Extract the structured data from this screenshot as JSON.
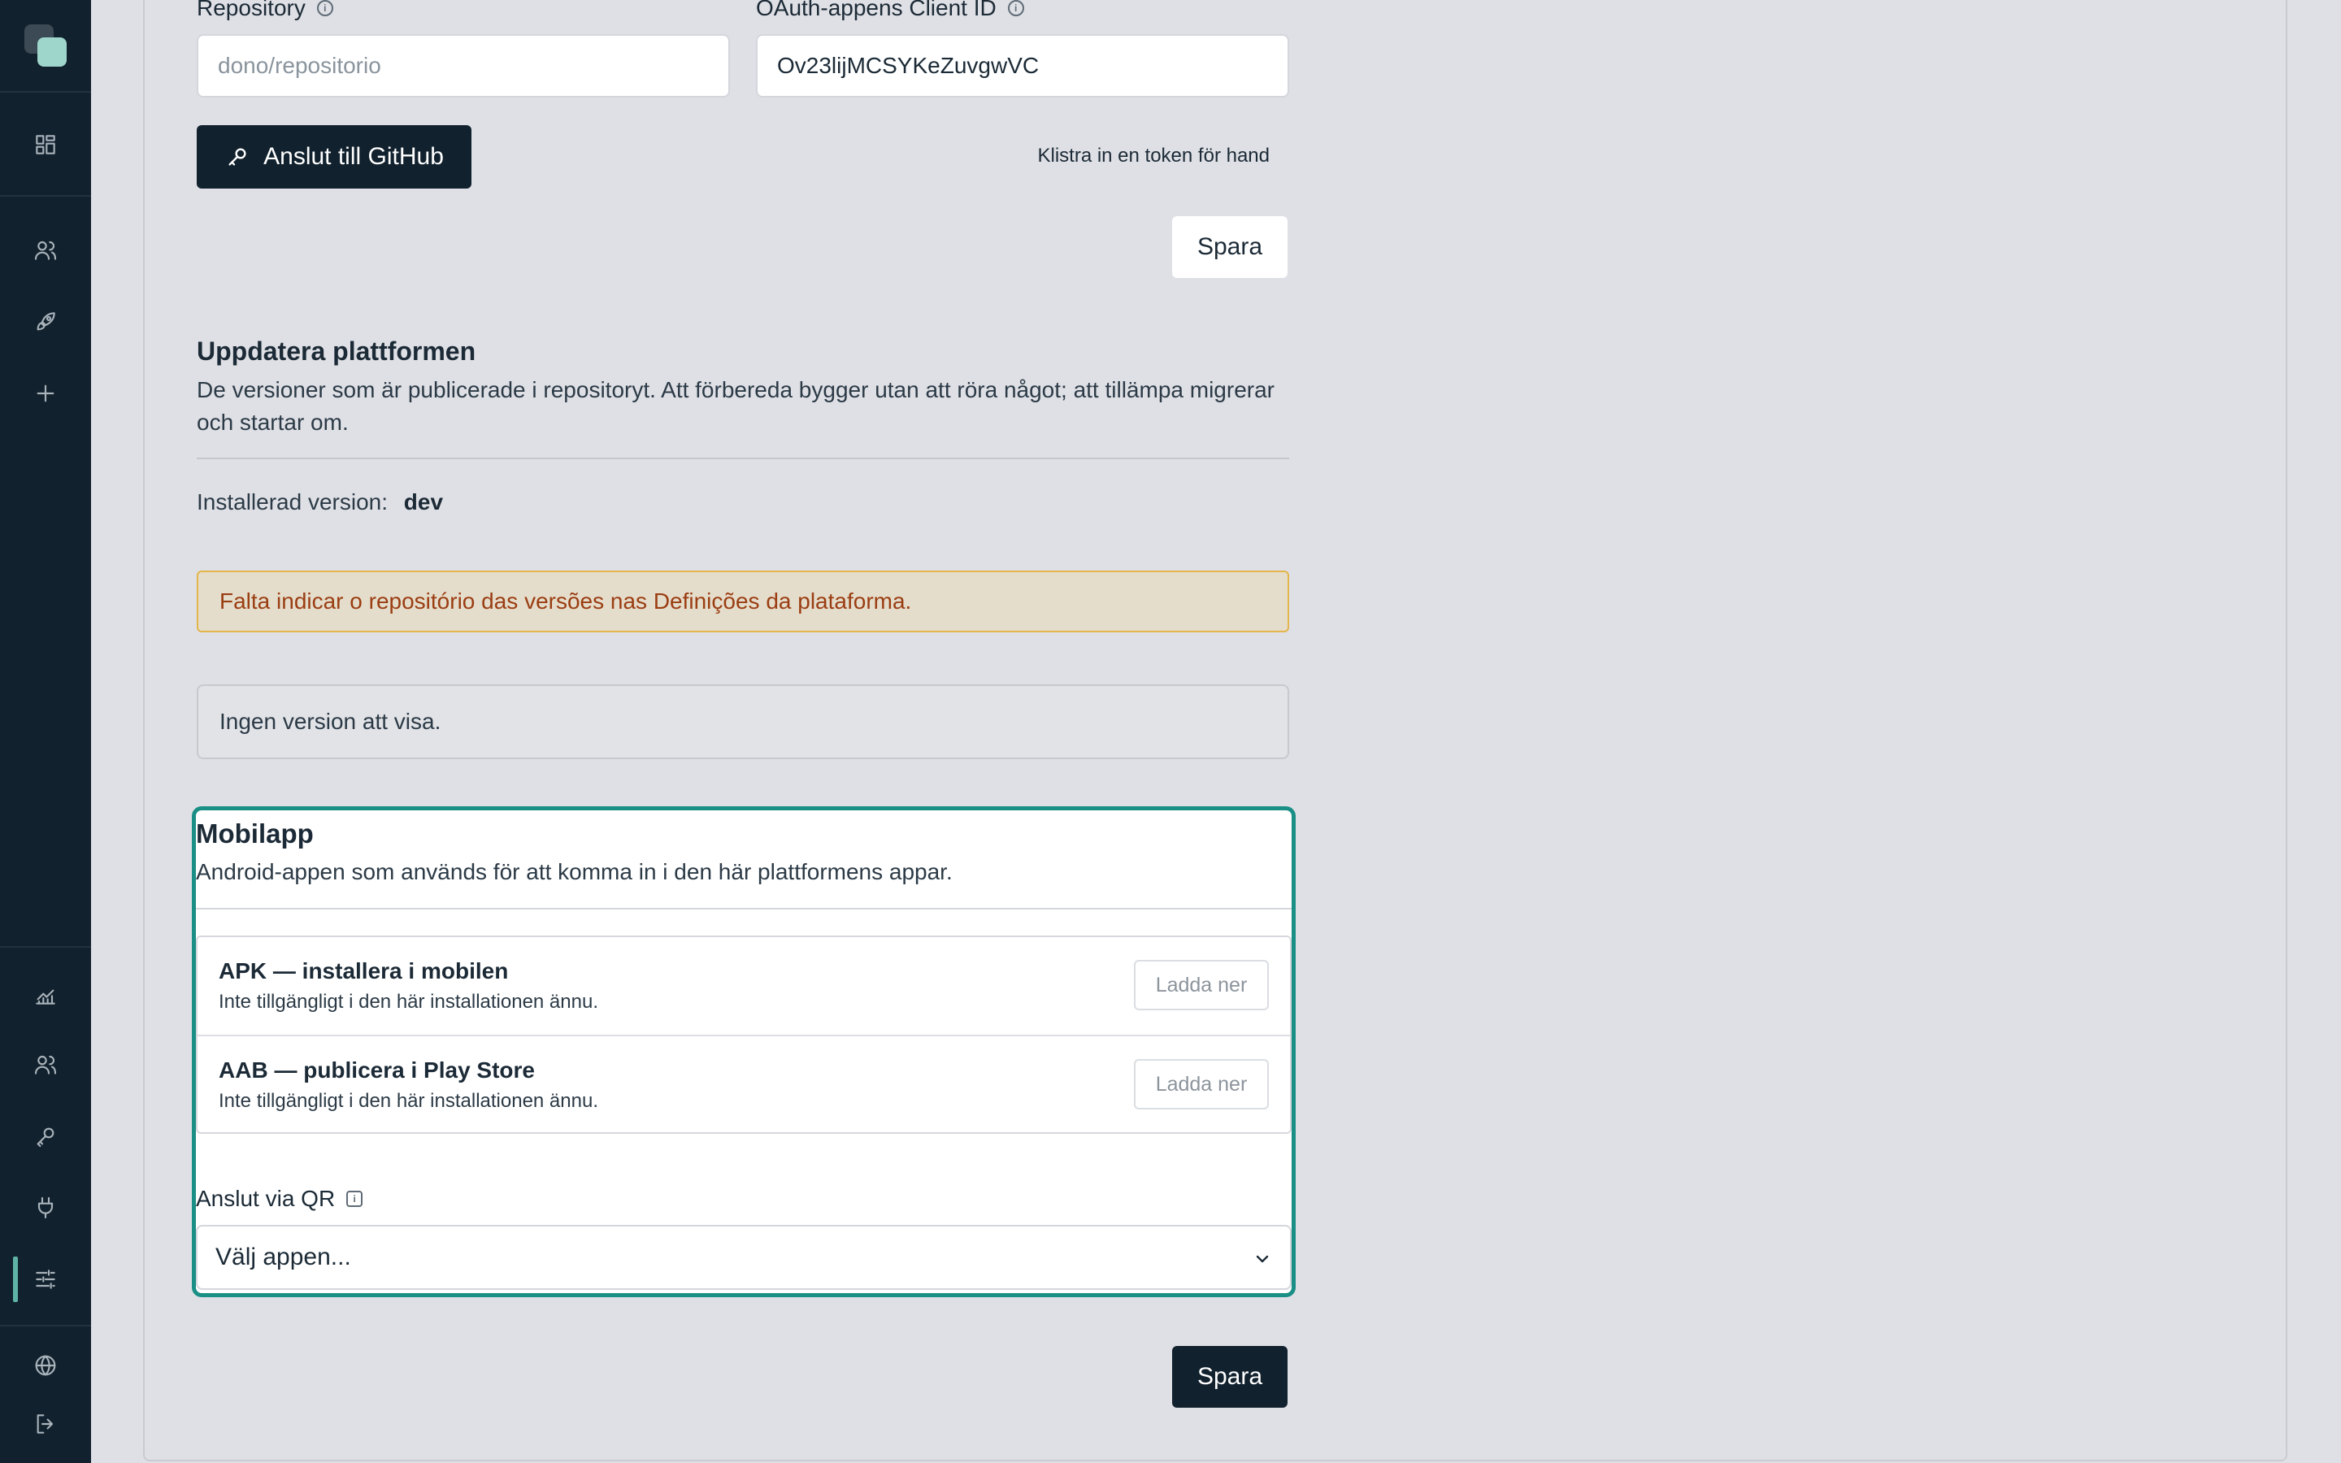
{
  "sidebar": {
    "items": [
      {
        "name": "dashboard-icon"
      },
      {
        "name": "users-icon"
      },
      {
        "name": "rocket-icon"
      },
      {
        "name": "plus-icon"
      },
      {
        "name": "analytics-icon"
      },
      {
        "name": "team-icon"
      },
      {
        "name": "key-icon"
      },
      {
        "name": "plug-icon"
      },
      {
        "name": "sliders-icon"
      },
      {
        "name": "globe-icon"
      },
      {
        "name": "logout-icon"
      }
    ],
    "active_item": "sliders-icon"
  },
  "github": {
    "repository_label": "Repository",
    "repository_placeholder": "dono/repositorio",
    "client_id_label": "OAuth-appens Client ID",
    "client_id_value": "Ov23lijMCSYKeZuvgwVC",
    "connect_button": "Anslut till GitHub",
    "manual_token_link": "Klistra in en token för hand",
    "save_button": "Spara"
  },
  "update_platform": {
    "title": "Uppdatera plattformen",
    "description": "De versioner som är publicerade i repositoryt. Att förbereda bygger utan att röra något; att tillämpa migrerar och startar om.",
    "installed_label": "Installerad version:",
    "installed_value": "dev",
    "warning": "Falta indicar o repositório das versões nas Definições da plataforma.",
    "empty_message": "Ingen version att visa."
  },
  "mobile_app": {
    "title": "Mobilapp",
    "description": "Android-appen som används för att komma in i den här plattformens appar.",
    "downloads": [
      {
        "title": "APK — installera i mobilen",
        "subtitle": "Inte tillgängligt i den här installationen ännu.",
        "button": "Ladda ner"
      },
      {
        "title": "AAB — publicera i Play Store",
        "subtitle": "Inte tillgängligt i den här installationen ännu.",
        "button": "Ladda ner"
      }
    ],
    "qr_label": "Anslut via QR",
    "qr_select_value": "Välj appen..."
  },
  "footer": {
    "save_button": "Spara"
  },
  "colors": {
    "sidebar_bg": "#11212d",
    "accent": "#1a8f85",
    "warning_border": "#e3b54a",
    "warning_text": "#9a3d12"
  }
}
